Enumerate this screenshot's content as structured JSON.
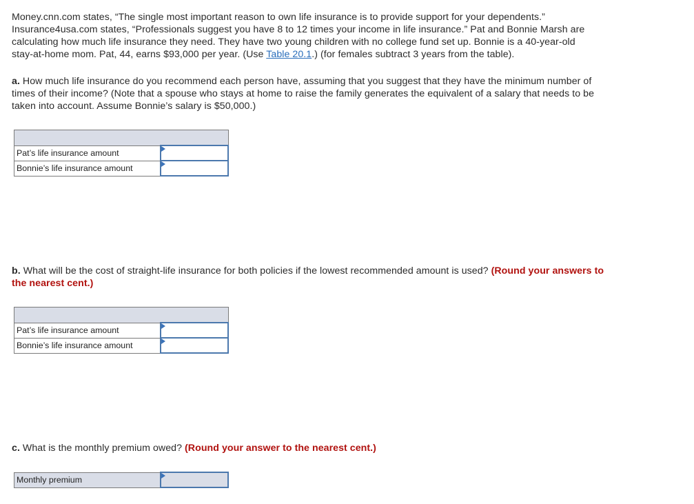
{
  "intro": {
    "line1": "Money.cnn.com states, “The single most important reason to own life insurance is to provide support for your dependents.”",
    "line2": "Insurance4usa.com states, “Professionals suggest you have 8 to 12 times your income in life insurance.” Pat and Bonnie Marsh are",
    "line3": "calculating how much life insurance they need. They have two young children with no college fund set up. Bonnie is a 40-year-old",
    "line4_before": "stay-at-home mom. Pat, 44, earns $93,000 per year. (Use ",
    "line4_link": "Table 20.1",
    "line4_after": ".) (for females subtract 3 years from the table)."
  },
  "part_a": {
    "letter": "a.",
    "line1": " How much life insurance do you recommend each person have, assuming that you suggest that they have the minimum number of",
    "line2": "times of their income? (Note that a spouse who stays at home to raise the family generates the equivalent of a salary that needs to be",
    "line3": "taken into account. Assume Bonnie’s salary is $50,000.)",
    "rows": [
      {
        "label": "Pat’s life insurance amount",
        "value": ""
      },
      {
        "label": "Bonnie’s life insurance amount",
        "value": ""
      }
    ]
  },
  "part_b": {
    "letter": "b.",
    "text": " What will be the cost of straight-life insurance for both policies if the lowest recommended amount is used? ",
    "instruction_1": "(Round your answers to",
    "instruction_2": "the nearest cent.)",
    "rows": [
      {
        "label": "Pat’s life insurance amount",
        "value": ""
      },
      {
        "label": "Bonnie’s life insurance amount",
        "value": ""
      }
    ]
  },
  "part_c": {
    "letter": "c.",
    "text": " What is the monthly premium owed? ",
    "instruction": "(Round your answer to the nearest cent.)",
    "rows": [
      {
        "label": "Monthly premium",
        "value": ""
      }
    ]
  },
  "colors": {
    "instruction_red": "#b1120f",
    "link_blue": "#2a6ebb",
    "table_header_bg": "#d9dde7",
    "input_border": "#4b78ad"
  }
}
